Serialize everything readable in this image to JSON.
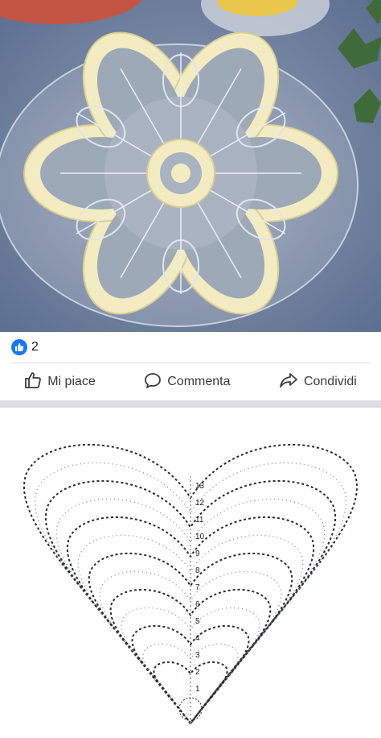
{
  "post": {
    "reaction_count": "2",
    "reaction_icon": "like-icon",
    "actions": {
      "like_label": "Mi piace",
      "comment_label": "Commenta",
      "share_label": "Condividi"
    }
  },
  "diagram": {
    "row_numbers": [
      "1",
      "2",
      "3",
      "4",
      "5",
      "6",
      "7",
      "8",
      "9",
      "10",
      "11",
      "12",
      "13"
    ]
  },
  "colors": {
    "accent": "#1877f2",
    "action_text": "#3a3b3c",
    "separator": "#dcdee3"
  }
}
